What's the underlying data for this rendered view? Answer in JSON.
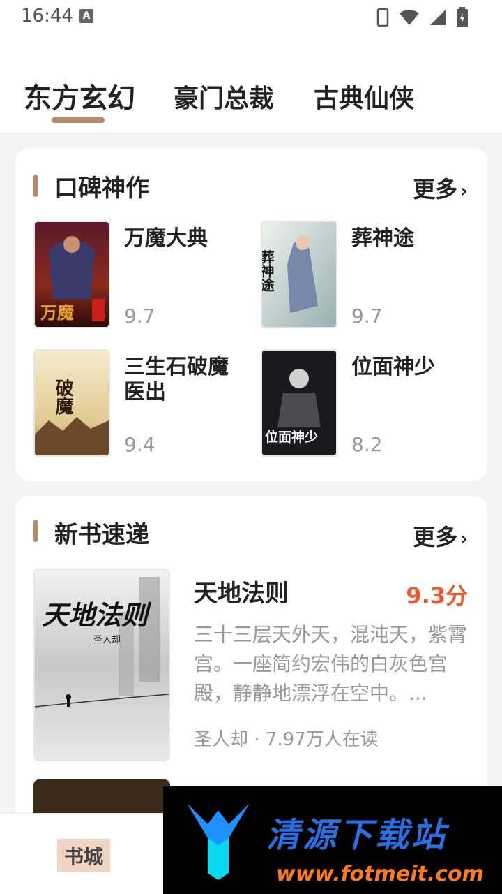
{
  "status_bar": {
    "time": "16:44",
    "badge": "A"
  },
  "tabs": [
    {
      "label": "东方玄幻"
    },
    {
      "label": "豪门总裁"
    },
    {
      "label": "古典仙侠"
    }
  ],
  "section_recommended": {
    "title": "口碑神作",
    "more_label": "更多",
    "books": [
      {
        "title": "万魔大典",
        "score": "9.7",
        "cover_text": "万魔"
      },
      {
        "title": "葬神途",
        "score": "9.7",
        "cover_text": "葬神途"
      },
      {
        "title": "三生石破魔医出",
        "score": "9.4",
        "cover_text": "破魔"
      },
      {
        "title": "位面神少",
        "score": "8.2",
        "cover_text": "位面神少"
      }
    ]
  },
  "section_new": {
    "title": "新书速递",
    "more_label": "更多",
    "featured": {
      "title": "天地法则",
      "score": "9.3分",
      "description": "三十三层天外天，混沌天，紫霄宫。一座简约宏伟的白灰色宫殿，静静地漂浮在空中。...",
      "meta": "圣人却 · 7.97万人在读",
      "cover_title": "天地法则",
      "cover_author": "圣人却"
    }
  },
  "bottom_nav": {
    "active_label": "书城"
  },
  "watermark": {
    "title": "清源下载站",
    "url": "www.fotmeit.com"
  },
  "colors": {
    "accent": "#b88a6a",
    "score_orange": "#f0582c"
  }
}
